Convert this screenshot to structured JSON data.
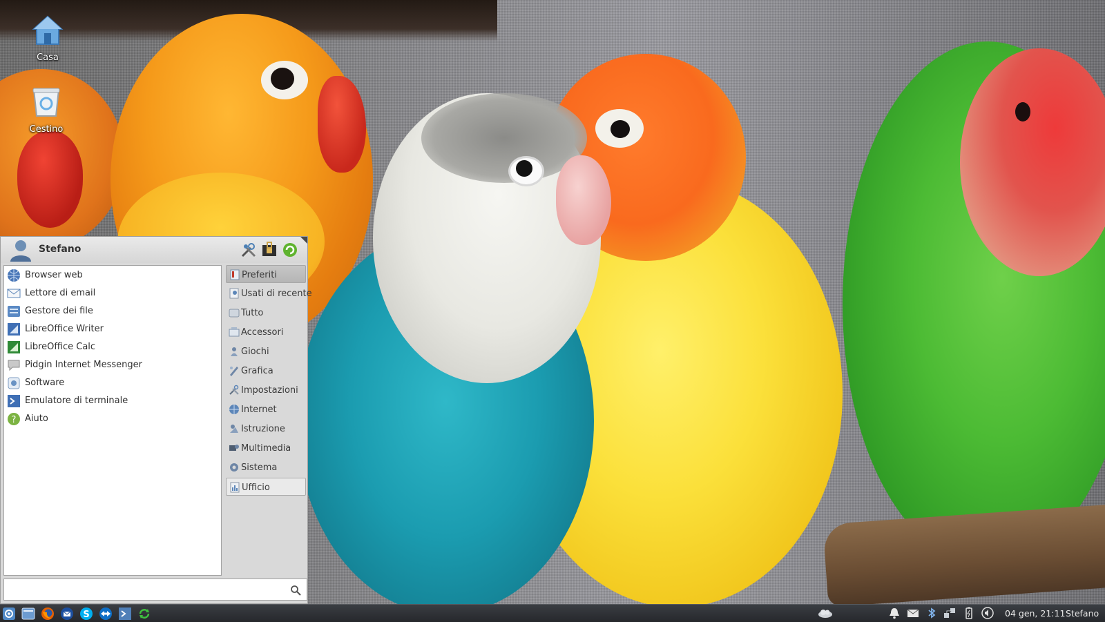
{
  "desktop": {
    "icons": [
      {
        "label": "Casa"
      },
      {
        "label": "Cestino"
      }
    ]
  },
  "menu": {
    "user": "Stefano",
    "header_buttons": [
      "settings-tools-icon",
      "lock-screen-icon",
      "logout-icon"
    ],
    "apps": [
      {
        "label": "Browser web",
        "icon": "globe-icon"
      },
      {
        "label": "Lettore di email",
        "icon": "mail-icon"
      },
      {
        "label": "Gestore dei file",
        "icon": "file-manager-icon"
      },
      {
        "label": "LibreOffice Writer",
        "icon": "writer-icon"
      },
      {
        "label": "LibreOffice Calc",
        "icon": "calc-icon"
      },
      {
        "label": "Pidgin Internet Messenger",
        "icon": "chat-bubble-icon"
      },
      {
        "label": "Software",
        "icon": "software-icon"
      },
      {
        "label": "Emulatore di terminale",
        "icon": "terminal-icon"
      },
      {
        "label": "Aiuto",
        "icon": "help-icon"
      }
    ],
    "categories": [
      {
        "label": "Preferiti",
        "state": "active"
      },
      {
        "label": "Usati di recente"
      },
      {
        "label": "Tutto"
      },
      {
        "label": "Accessori"
      },
      {
        "label": "Giochi"
      },
      {
        "label": "Grafica"
      },
      {
        "label": "Impostazioni"
      },
      {
        "label": "Internet"
      },
      {
        "label": "Istruzione"
      },
      {
        "label": "Multimedia"
      },
      {
        "label": "Sistema"
      },
      {
        "label": "Ufficio",
        "state": "hovered"
      }
    ],
    "search": {
      "value": "",
      "placeholder": ""
    }
  },
  "taskbar": {
    "launchers": [
      "menu-icon",
      "show-desktop-icon",
      "firefox-icon",
      "thunderbird-icon",
      "skype-icon",
      "teamviewer-icon",
      "terminal-icon",
      "refresh-icon"
    ],
    "tray": [
      "weather-icon",
      "notification-bell-icon",
      "mail-icon",
      "bluetooth-icon",
      "network-icon",
      "battery-icon",
      "volume-icon"
    ],
    "clock": "04 gen, 21:11",
    "user": "Stefano"
  },
  "colors": {
    "taskbar_bg": "#2e3035",
    "menu_bg": "#d9d9d9",
    "category_active": "#bcbcbc"
  }
}
